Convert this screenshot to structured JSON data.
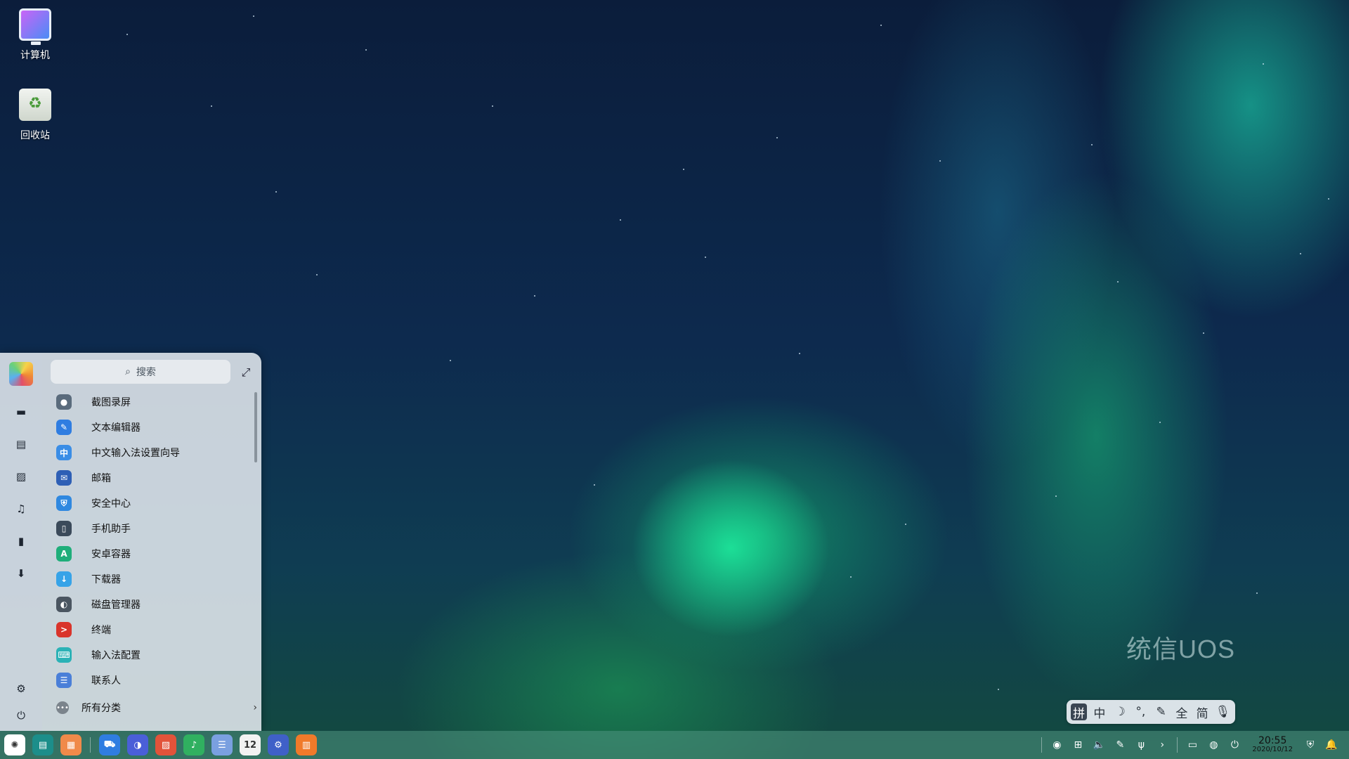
{
  "desktop": {
    "icons": [
      {
        "label": "计算机",
        "icon": "computer-icon"
      },
      {
        "label": "回收站",
        "icon": "trash-icon"
      }
    ],
    "watermark": "统信UOS"
  },
  "launcher": {
    "search_placeholder": "搜索",
    "rail": [
      "desktop-icon",
      "document-icon",
      "picture-icon",
      "music-icon",
      "video-icon",
      "download-icon",
      "settings-icon",
      "power-icon"
    ],
    "apps": [
      {
        "label": "截图录屏",
        "color": "#5a6b7c",
        "glyph": "●"
      },
      {
        "label": "文本编辑器",
        "color": "#2f7de1",
        "glyph": "✎"
      },
      {
        "label": "中文输入法设置向导",
        "color": "#3a8de6",
        "glyph": "中"
      },
      {
        "label": "邮箱",
        "color": "#2e5fb5",
        "glyph": "✉"
      },
      {
        "label": "安全中心",
        "color": "#2f88e0",
        "glyph": "⛨"
      },
      {
        "label": "手机助手",
        "color": "#3b4a5a",
        "glyph": "▯"
      },
      {
        "label": "安卓容器",
        "color": "#1fae7a",
        "glyph": "A"
      },
      {
        "label": "下载器",
        "color": "#36a3e8",
        "glyph": "↓"
      },
      {
        "label": "磁盘管理器",
        "color": "#4a5560",
        "glyph": "◐"
      },
      {
        "label": "终端",
        "color": "#d9342b",
        "glyph": ">"
      },
      {
        "label": "输入法配置",
        "color": "#2bb2b6",
        "glyph": "⌨"
      },
      {
        "label": "联系人",
        "color": "#4a7fd8",
        "glyph": "☰"
      }
    ],
    "all_categories": "所有分类"
  },
  "ime": {
    "items": [
      "拼",
      "中",
      "☽",
      "°,",
      "✎",
      "全",
      "简",
      "🎙"
    ]
  },
  "taskbar": {
    "apps": [
      {
        "name": "launcher",
        "color": "#ffffff",
        "glyph": "✺"
      },
      {
        "name": "multitask-view",
        "color": "#1c8e8a",
        "glyph": "▤"
      },
      {
        "name": "file-manager",
        "color": "#f08a4a",
        "glyph": "▦"
      },
      {
        "name": "app-store",
        "color": "#2f7de1",
        "glyph": "⛟"
      },
      {
        "name": "browser",
        "color": "#4a5fd8",
        "glyph": "◑"
      },
      {
        "name": "image-viewer",
        "color": "#e2533a",
        "glyph": "▨"
      },
      {
        "name": "music",
        "color": "#30b060",
        "glyph": "♪"
      },
      {
        "name": "document-viewer",
        "color": "#7aa0e0",
        "glyph": "☰"
      },
      {
        "name": "calendar",
        "color": "#f2f2f2",
        "glyph": "12"
      },
      {
        "name": "control-center",
        "color": "#3f60c8",
        "glyph": "⚙"
      },
      {
        "name": "app-market",
        "color": "#f07a2a",
        "glyph": "▥"
      }
    ],
    "tray": [
      "screenshot-icon",
      "keyboard-icon",
      "volume-icon",
      "pen-icon",
      "usb-icon",
      "chevron-right-icon",
      "display-icon",
      "network-icon",
      "power-icon"
    ],
    "time": "20:55",
    "date": "2020/10/12"
  }
}
